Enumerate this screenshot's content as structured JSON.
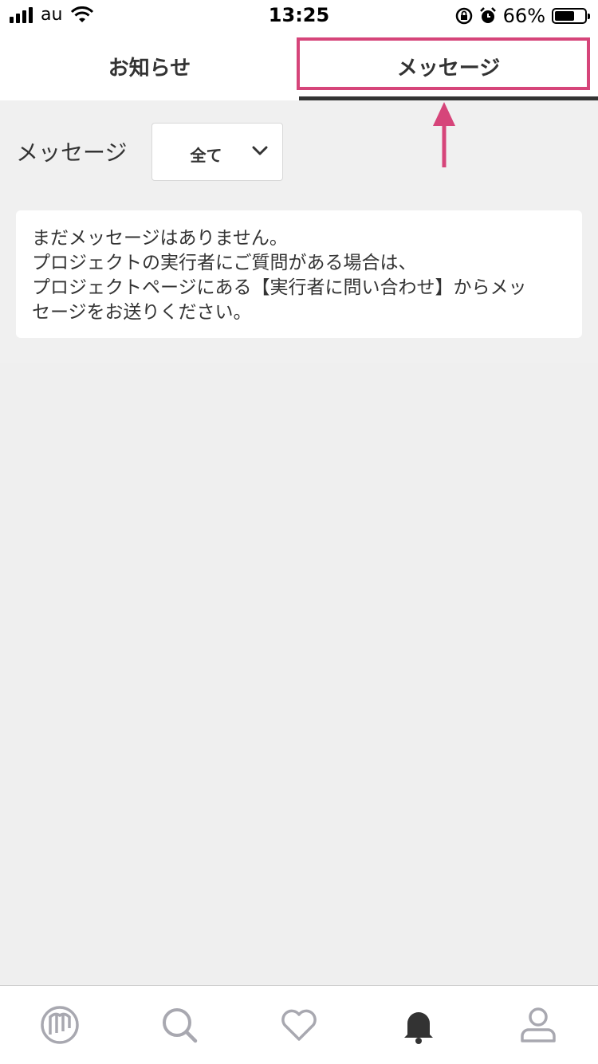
{
  "status": {
    "carrier": "au",
    "time": "13:25",
    "battery": "66%",
    "battery_level": 0.66
  },
  "tabs": [
    {
      "label": "お知らせ",
      "active": false
    },
    {
      "label": "メッセージ",
      "active": true
    }
  ],
  "filter": {
    "label": "メッセージ",
    "selected": "全て"
  },
  "empty_message": {
    "line1": "まだメッセージはありません。",
    "line2": "プロジェクトの実行者にご質問がある場合は、",
    "line3": "プロジェクトページにある【実行者に問い合わせ】からメッ",
    "line4": "セージをお送りください。"
  },
  "colors": {
    "highlight": "#d6457a",
    "text": "#333333",
    "background": "#f0f0f0"
  },
  "bottom_nav": [
    {
      "icon": "home-logo-icon",
      "active": false
    },
    {
      "icon": "search-icon",
      "active": false
    },
    {
      "icon": "heart-icon",
      "active": false
    },
    {
      "icon": "bell-icon",
      "active": true
    },
    {
      "icon": "profile-icon",
      "active": false
    }
  ]
}
